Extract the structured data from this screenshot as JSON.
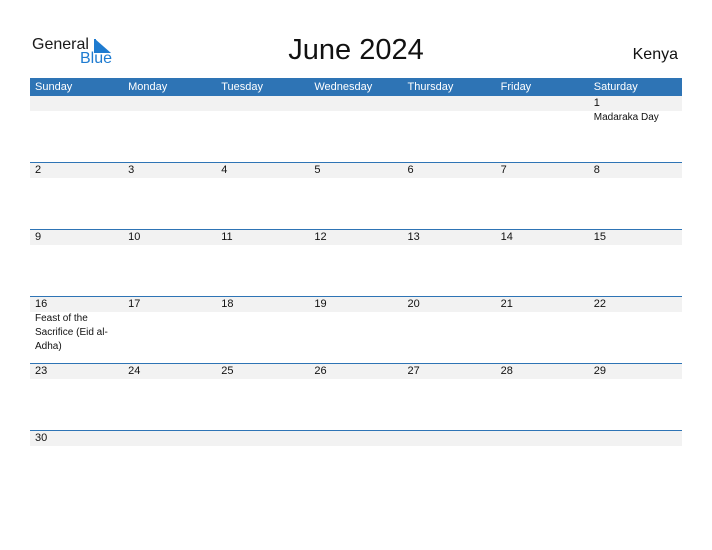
{
  "brand": {
    "word1": "General",
    "word2": "Blue"
  },
  "title": "June 2024",
  "country": "Kenya",
  "weekdays": [
    "Sunday",
    "Monday",
    "Tuesday",
    "Wednesday",
    "Thursday",
    "Friday",
    "Saturday"
  ],
  "weeks": [
    [
      {
        "n": ""
      },
      {
        "n": ""
      },
      {
        "n": ""
      },
      {
        "n": ""
      },
      {
        "n": ""
      },
      {
        "n": ""
      },
      {
        "n": "1",
        "h": "Madaraka Day"
      }
    ],
    [
      {
        "n": "2"
      },
      {
        "n": "3"
      },
      {
        "n": "4"
      },
      {
        "n": "5"
      },
      {
        "n": "6"
      },
      {
        "n": "7"
      },
      {
        "n": "8"
      }
    ],
    [
      {
        "n": "9"
      },
      {
        "n": "10"
      },
      {
        "n": "11"
      },
      {
        "n": "12"
      },
      {
        "n": "13"
      },
      {
        "n": "14"
      },
      {
        "n": "15"
      }
    ],
    [
      {
        "n": "16",
        "h": "Feast of the Sacrifice (Eid al-Adha)"
      },
      {
        "n": "17"
      },
      {
        "n": "18"
      },
      {
        "n": "19"
      },
      {
        "n": "20"
      },
      {
        "n": "21"
      },
      {
        "n": "22"
      }
    ],
    [
      {
        "n": "23"
      },
      {
        "n": "24"
      },
      {
        "n": "25"
      },
      {
        "n": "26"
      },
      {
        "n": "27"
      },
      {
        "n": "28"
      },
      {
        "n": "29"
      }
    ],
    [
      {
        "n": "30"
      },
      {
        "n": ""
      },
      {
        "n": ""
      },
      {
        "n": ""
      },
      {
        "n": ""
      },
      {
        "n": ""
      },
      {
        "n": ""
      }
    ]
  ]
}
